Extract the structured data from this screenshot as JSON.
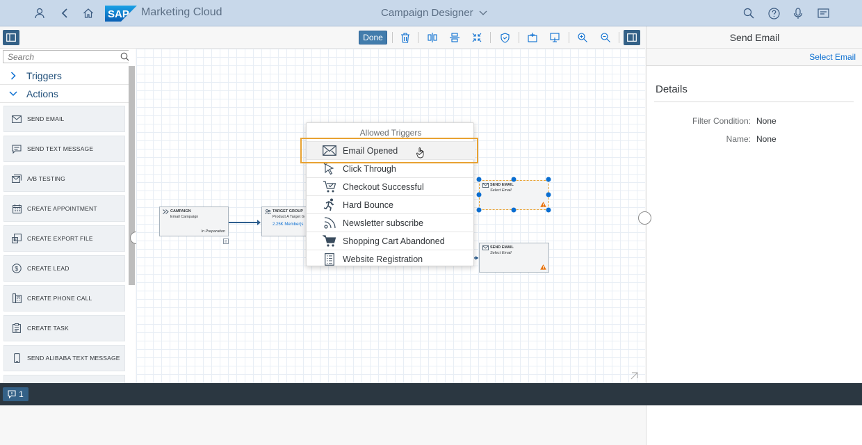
{
  "shell": {
    "logo_text": "SAP",
    "app_title": "Marketing Cloud",
    "center_title": "Campaign Designer",
    "icons": [
      "user-icon",
      "back-icon",
      "home-icon",
      "search-icon",
      "help-icon",
      "microphone-icon",
      "notifications-icon"
    ]
  },
  "toolbar": {
    "done_label": "Done",
    "icons": [
      "delete-icon",
      "align-horizontal-icon",
      "align-vertical-icon",
      "collapse-icon",
      "shield-icon",
      "insert-before-icon",
      "insert-after-icon",
      "zoom-in-icon",
      "zoom-out-icon",
      "side-panel-icon"
    ]
  },
  "left_panel": {
    "search_placeholder": "Search",
    "sections": [
      {
        "label": "Triggers",
        "expanded": false
      },
      {
        "label": "Actions",
        "expanded": true
      }
    ],
    "actions": [
      {
        "label": "SEND EMAIL",
        "icon": "email-icon"
      },
      {
        "label": "SEND TEXT MESSAGE",
        "icon": "text-message-icon"
      },
      {
        "label": "A/B TESTING",
        "icon": "ab-testing-icon"
      },
      {
        "label": "CREATE APPOINTMENT",
        "icon": "appointment-icon"
      },
      {
        "label": "CREATE EXPORT FILE",
        "icon": "export-icon"
      },
      {
        "label": "CREATE LEAD",
        "icon": "lead-icon"
      },
      {
        "label": "CREATE PHONE CALL",
        "icon": "phone-call-icon"
      },
      {
        "label": "CREATE TASK",
        "icon": "task-icon"
      },
      {
        "label": "SEND ALIBABA TEXT MESSAGE",
        "icon": "mobile-icon"
      }
    ]
  },
  "canvas": {
    "nodes": {
      "campaign": {
        "title": "CAMPAIGN",
        "subtitle": "Email Campaign",
        "status": "In Preparation"
      },
      "target_group": {
        "title": "TARGET GROUP",
        "subtitle": "Product A Target G",
        "members": "2.25K Member(s"
      },
      "send_email_1": {
        "title": "SEND EMAIL",
        "subtitle": "Select Email"
      },
      "send_email_2": {
        "title": "SEND EMAIL",
        "subtitle": "Select Email"
      }
    },
    "popover": {
      "title": "Allowed Triggers",
      "items": [
        {
          "label": "Email Opened",
          "icon": "email-opened-icon"
        },
        {
          "label": "Click Through",
          "icon": "cursor-icon"
        },
        {
          "label": "Checkout Successful",
          "icon": "cart-checkout-icon"
        },
        {
          "label": "Hard Bounce",
          "icon": "bounce-icon"
        },
        {
          "label": "Newsletter subscribe",
          "icon": "rss-icon"
        },
        {
          "label": "Shopping Cart Abandoned",
          "icon": "cart-icon"
        },
        {
          "label": "Website Registration",
          "icon": "form-icon"
        }
      ]
    }
  },
  "right_panel": {
    "title": "Send Email",
    "select_link": "Select Email",
    "section_title": "Details",
    "fields": [
      {
        "label": "Filter Condition:",
        "value": "None"
      },
      {
        "label": "Name:",
        "value": "None"
      }
    ]
  },
  "footer": {
    "message_count": "1"
  },
  "colors": {
    "shell_bg": "#c8d8ea",
    "accent": "#0a6ed1",
    "button_bg": "#427cac",
    "highlight": "#e8a232",
    "footer_bg": "#2b3741"
  }
}
